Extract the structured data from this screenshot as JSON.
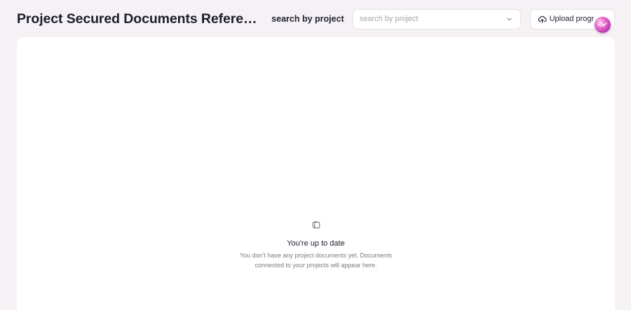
{
  "header": {
    "title": "Project Secured Documents Reference...",
    "search_label": "search by project",
    "select_placeholder": "search by project",
    "upload_label": "Upload progr"
  },
  "empty_state": {
    "title": "You're up to date",
    "description": "You don't have any project documents yet. Documents connected to your projects will appear here."
  },
  "icons": {
    "select": "chevron-down-icon",
    "upload": "cloud-upload-icon",
    "empty": "documents-icon",
    "assistant": "assistant-orb-icon"
  },
  "colors": {
    "background": "#f5f1f5",
    "panel": "#ffffff",
    "border": "#e5e0e6",
    "orb": "#ee6ad0"
  }
}
